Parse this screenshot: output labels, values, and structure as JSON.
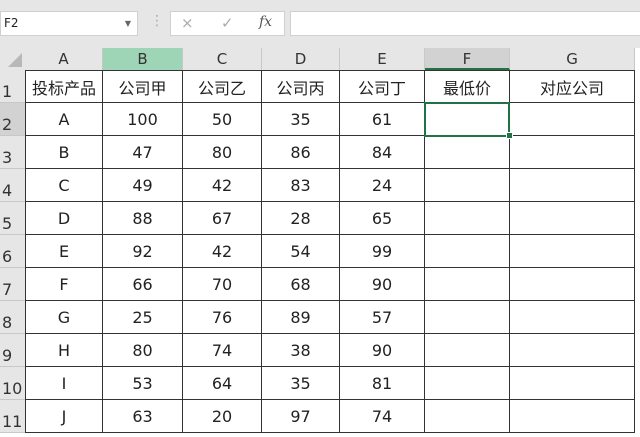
{
  "name_box": "F2",
  "formula_bar": {
    "cancel_icon": "×",
    "enter_icon": "✓",
    "fx_label": "fx",
    "value": ""
  },
  "columns": [
    "A",
    "B",
    "C",
    "D",
    "E",
    "F",
    "G"
  ],
  "rows": [
    "1",
    "2",
    "3",
    "4",
    "5",
    "6",
    "7",
    "8",
    "9",
    "10",
    "11"
  ],
  "table": [
    [
      "投标产品",
      "公司甲",
      "公司乙",
      "公司丙",
      "公司丁",
      "最低价",
      "对应公司"
    ],
    [
      "A",
      "100",
      "50",
      "35",
      "61",
      "",
      ""
    ],
    [
      "B",
      "47",
      "80",
      "86",
      "84",
      "",
      ""
    ],
    [
      "C",
      "49",
      "42",
      "83",
      "24",
      "",
      ""
    ],
    [
      "D",
      "88",
      "67",
      "28",
      "65",
      "",
      ""
    ],
    [
      "E",
      "92",
      "42",
      "54",
      "99",
      "",
      ""
    ],
    [
      "F",
      "66",
      "70",
      "68",
      "90",
      "",
      ""
    ],
    [
      "G",
      "25",
      "76",
      "89",
      "57",
      "",
      ""
    ],
    [
      "H",
      "80",
      "74",
      "38",
      "90",
      "",
      ""
    ],
    [
      "I",
      "53",
      "64",
      "35",
      "81",
      "",
      ""
    ],
    [
      "J",
      "63",
      "20",
      "97",
      "74",
      "",
      ""
    ]
  ],
  "colors": {
    "selection": "#217346",
    "highlight_column": "#9fd5b7"
  }
}
